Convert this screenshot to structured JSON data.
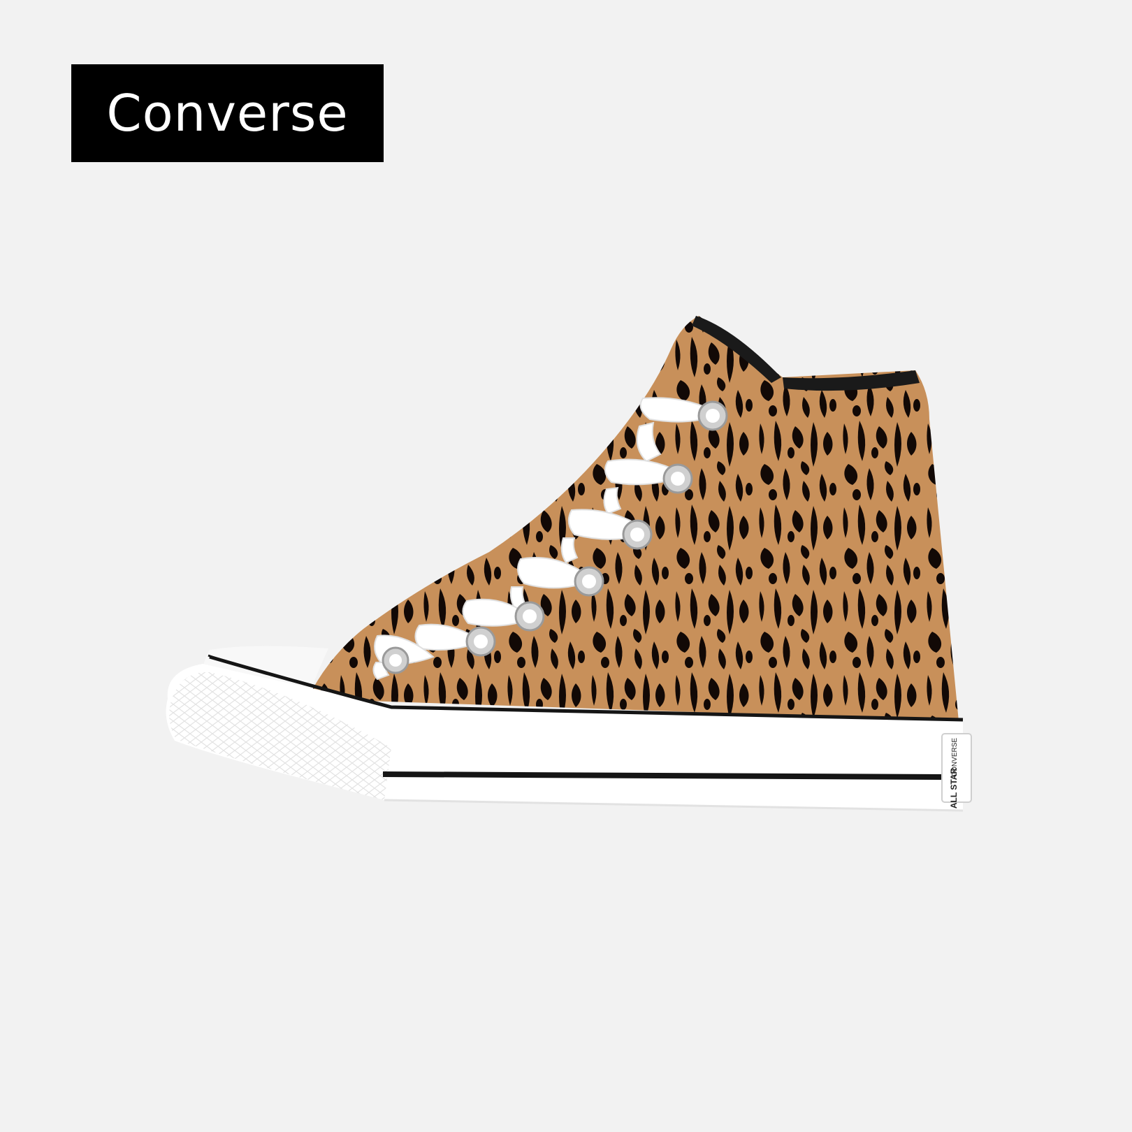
{
  "brand": {
    "label": "Converse",
    "badge_color": "#000000",
    "text_color": "#ffffff"
  },
  "background_color": "#f2f2f2",
  "product": {
    "heel_label_text": [
      "CONVERSE",
      "ALL STAR"
    ],
    "colors": {
      "canvas_base": "#c8905a",
      "canvas_print": "#120906",
      "rubber": "#ffffff",
      "foxing_stripe": "#151515",
      "laces": "#ffffff",
      "eyelets": "#c9c9c9"
    }
  }
}
